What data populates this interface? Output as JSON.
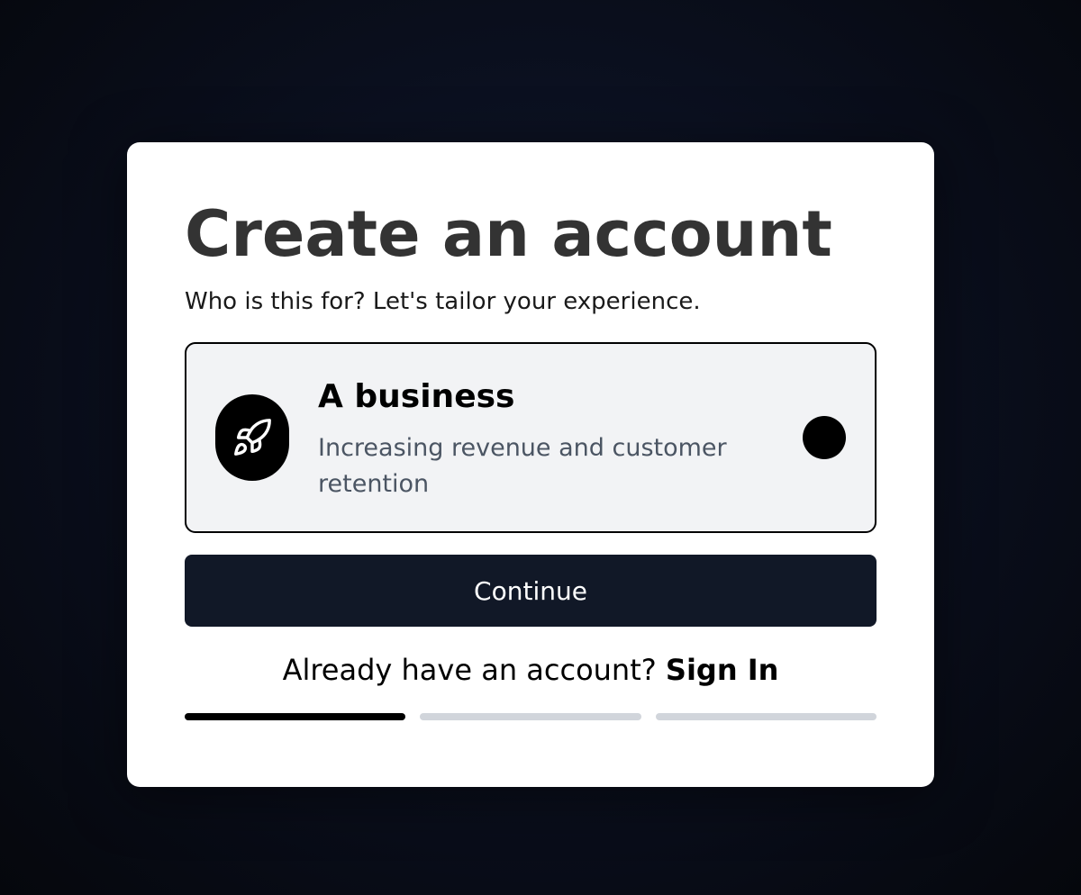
{
  "modal": {
    "title": "Create an account",
    "subtitle": "Who is this for? Let's tailor your experience."
  },
  "option": {
    "icon": "rocket-icon",
    "title": "A business",
    "description": "Increasing revenue and customer retention",
    "selected": true
  },
  "actions": {
    "continue_label": "Continue",
    "signin_prompt": "Already have an account?",
    "signin_link": "Sign In"
  },
  "progress": {
    "current_step": 1,
    "total_steps": 3
  },
  "colors": {
    "button_bg": "#111827",
    "card_bg": "#f2f3f5",
    "progress_active": "#000000",
    "progress_inactive": "#d1d5db"
  }
}
